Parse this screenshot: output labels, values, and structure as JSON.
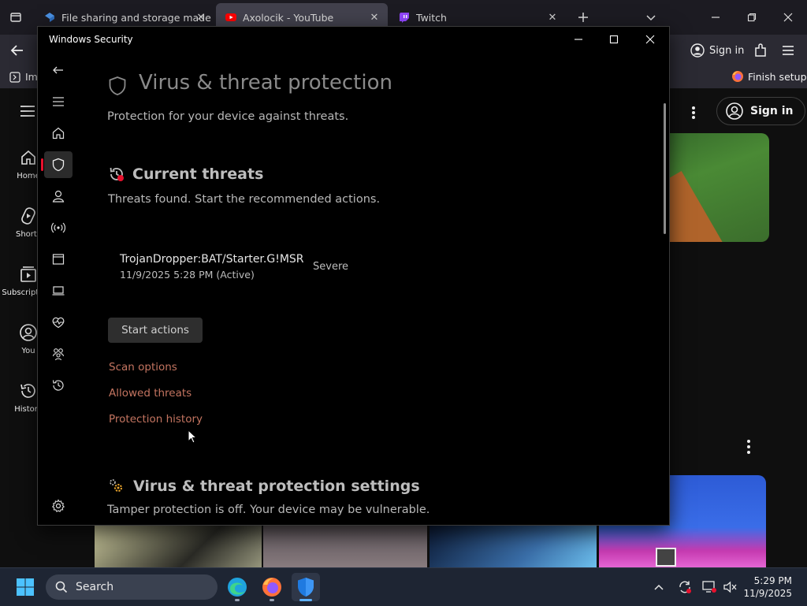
{
  "browser": {
    "tabs": [
      {
        "label": "File sharing and storage made s…",
        "favicon": "dropbox-icon",
        "active": false
      },
      {
        "label": "Axolocik - YouTube",
        "favicon": "youtube-icon",
        "active": true
      },
      {
        "label": "Twitch",
        "favicon": "twitch-icon",
        "active": false
      }
    ],
    "sign_in": "Sign in",
    "finish_setup": "Finish setup",
    "bookmark_import": "Imp"
  },
  "youtube": {
    "sign_in": "Sign in",
    "nav": [
      {
        "label": "Home",
        "icon": "home-icon"
      },
      {
        "label": "Shorts",
        "icon": "shorts-icon"
      },
      {
        "label": "Subscriptions",
        "icon": "subscriptions-icon"
      },
      {
        "label": "You",
        "icon": "you-icon"
      },
      {
        "label": "History",
        "icon": "history-icon"
      }
    ]
  },
  "security": {
    "window_title": "Windows Security",
    "page_title": "Virus & threat protection",
    "page_subtitle": "Protection for your device against threats.",
    "current_threats": {
      "heading": "Current threats",
      "description": "Threats found. Start the recommended actions.",
      "threat": {
        "name": "TrojanDropper:BAT/Starter.G!MSR",
        "detected": "11/9/2025 5:28 PM (Active)",
        "severity": "Severe"
      },
      "start_actions": "Start actions",
      "links": [
        "Scan options",
        "Allowed threats",
        "Protection history"
      ]
    },
    "settings": {
      "heading": "Virus & threat protection settings",
      "description": "Tamper protection is off. Your device may be vulnerable."
    }
  },
  "taskbar": {
    "search": "Search",
    "time": "5:29 PM",
    "date": "11/9/2025"
  },
  "colors": {
    "link": "#c37460",
    "selected_indicator": "#e8112d",
    "taskbar": "#1e2533",
    "security_bg": "#000000"
  }
}
